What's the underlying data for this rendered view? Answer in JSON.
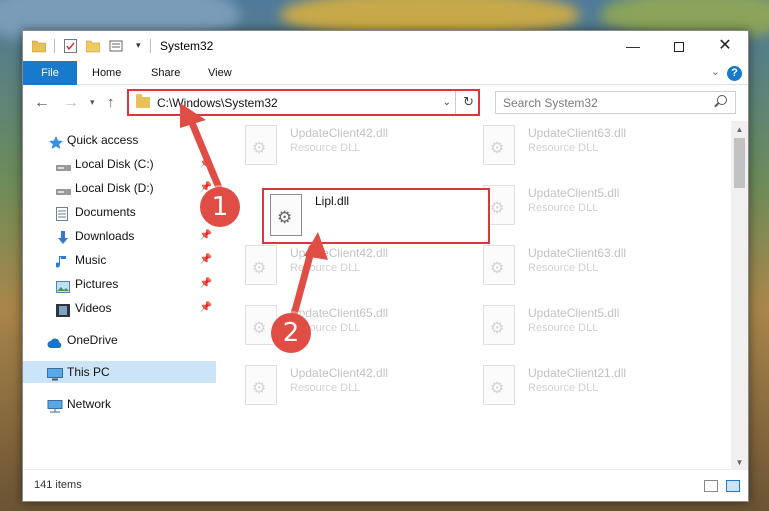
{
  "window": {
    "title": "System32",
    "controls": {
      "minimize": "—",
      "maximize": "",
      "close": "✕"
    }
  },
  "ribbon": {
    "tabs": [
      "File",
      "Home",
      "Share",
      "View"
    ],
    "help": "?"
  },
  "address": {
    "path": "C:\\Windows\\System32",
    "search_placeholder": "Search System32"
  },
  "sidebar": {
    "items": [
      {
        "label": "Quick access",
        "icon": "star-icon",
        "pinned": false
      },
      {
        "label": "Local Disk (C:)",
        "icon": "drive-icon",
        "pinned": true
      },
      {
        "label": "Local Disk (D:)",
        "icon": "drive-icon",
        "pinned": true
      },
      {
        "label": "Documents",
        "icon": "documents-icon",
        "pinned": true
      },
      {
        "label": "Downloads",
        "icon": "download-icon",
        "pinned": true
      },
      {
        "label": "Music",
        "icon": "music-icon",
        "pinned": true
      },
      {
        "label": "Pictures",
        "icon": "pictures-icon",
        "pinned": true
      },
      {
        "label": "Videos",
        "icon": "videos-icon",
        "pinned": true
      },
      {
        "label": "OneDrive",
        "icon": "cloud-icon",
        "pinned": false
      },
      {
        "label": "This PC",
        "icon": "computer-icon",
        "pinned": false,
        "selected": true
      },
      {
        "label": "Network",
        "icon": "network-icon",
        "pinned": false
      }
    ]
  },
  "files": {
    "left": [
      {
        "name": "UpdateClient42.dll",
        "type": "Resource DLL"
      },
      {
        "name": "UpdateClient42.dll",
        "type": "Resource DLL"
      },
      {
        "name": "UpdateClient65.dll",
        "type": "Resource DLL"
      },
      {
        "name": "UpdateClient42.dll",
        "type": "Resource DLL"
      }
    ],
    "right": [
      {
        "name": "UpdateClient63.dll",
        "type": "Resource DLL"
      },
      {
        "name": "UpdateClient5.dll",
        "type": "Resource DLL"
      },
      {
        "name": "UpdateClient63.dll",
        "type": "Resource DLL"
      },
      {
        "name": "UpdateClient5.dll",
        "type": "Resource DLL"
      },
      {
        "name": "UpdateClient21.dll",
        "type": "Resource DLL"
      }
    ],
    "highlighted": {
      "name": "Lipl.dll"
    }
  },
  "status": {
    "item_count": "141 items"
  },
  "annotations": {
    "step1": "1",
    "step2": "2",
    "accent": "#d9383a"
  }
}
